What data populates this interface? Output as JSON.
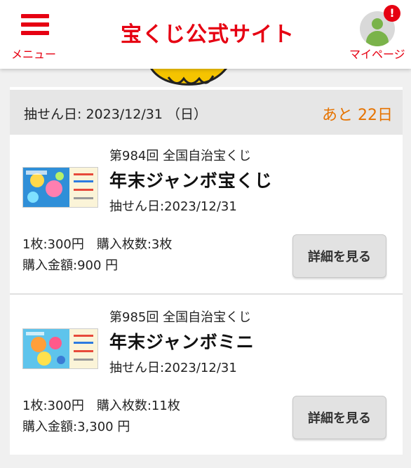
{
  "header": {
    "menu_label": "メニュー",
    "site_title": "宝くじ公式サイト",
    "mypage_label": "マイページ",
    "notification_badge": "!",
    "brand_color": "#e60012"
  },
  "draw": {
    "date_label": "抽せん日: 2023/12/31 （日）",
    "remaining": "あと 22日",
    "remaining_color": "#e67300"
  },
  "lotteries": [
    {
      "round": "第984回 全国自治宝くじ",
      "name": "年末ジャンボ宝くじ",
      "draw_date": "抽せん日:2023/12/31",
      "price_and_quantity": "1枚:300円　購入枚数:3枚",
      "total": "購入金額:900 円",
      "detail_button": "詳細を見る"
    },
    {
      "round": "第985回 全国自治宝くじ",
      "name": "年末ジャンボミニ",
      "draw_date": "抽せん日:2023/12/31",
      "price_and_quantity": "1枚:300円　購入枚数:11枚",
      "total": "購入金額:3,300 円",
      "detail_button": "詳細を見る"
    }
  ]
}
